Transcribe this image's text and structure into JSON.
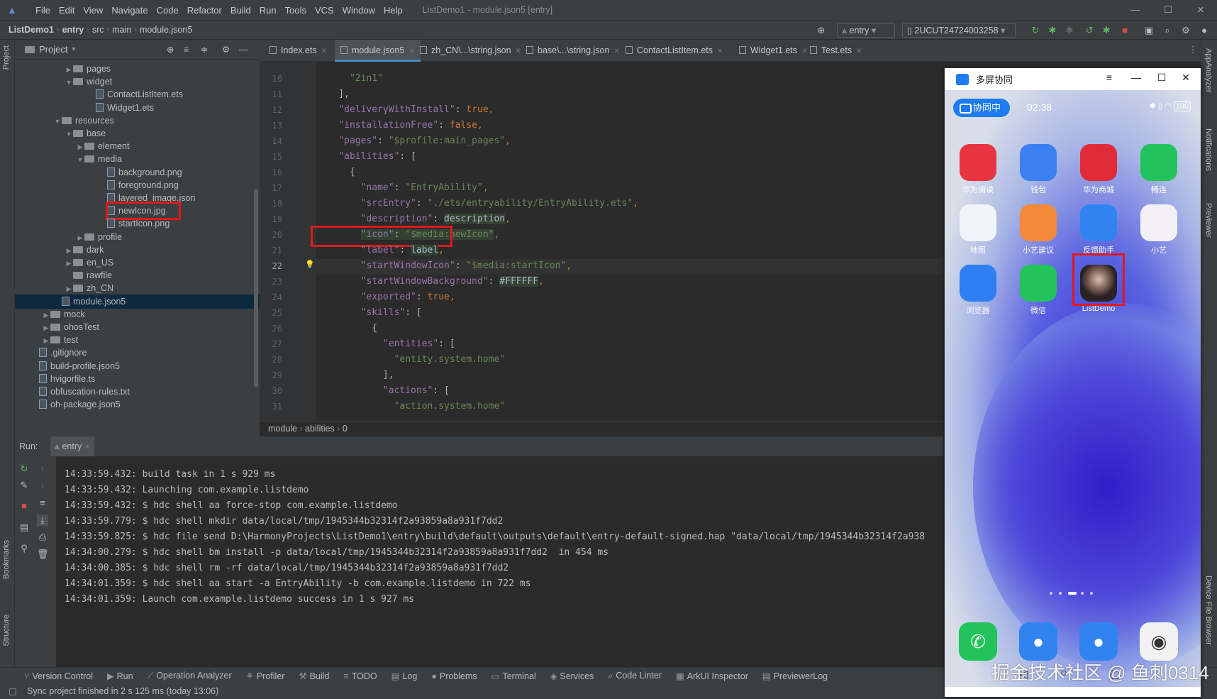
{
  "window": {
    "title": "ListDemo1 - module.json5 [entry]",
    "menu": [
      "File",
      "Edit",
      "View",
      "Navigate",
      "Code",
      "Refactor",
      "Build",
      "Run",
      "Tools",
      "VCS",
      "Window",
      "Help"
    ]
  },
  "navbar": {
    "breadcrumbs": [
      "ListDemo1",
      "entry",
      "src",
      "main",
      "module.json5"
    ],
    "run_config": "entry",
    "device": "2UCUT24724003258"
  },
  "project": {
    "title": "Project",
    "tree": [
      {
        "label": "pages",
        "kind": "folder",
        "depth": 5,
        "arrow": "right"
      },
      {
        "label": "widget",
        "kind": "folder",
        "depth": 5,
        "arrow": "down"
      },
      {
        "label": "ContactListItem.ets",
        "kind": "file",
        "depth": 7
      },
      {
        "label": "Widget1.ets",
        "kind": "file",
        "depth": 7
      },
      {
        "label": "resources",
        "kind": "folder",
        "depth": 4,
        "arrow": "down"
      },
      {
        "label": "base",
        "kind": "folder",
        "depth": 5,
        "arrow": "down"
      },
      {
        "label": "element",
        "kind": "folder",
        "depth": 6,
        "arrow": "right"
      },
      {
        "label": "media",
        "kind": "folder",
        "depth": 6,
        "arrow": "down"
      },
      {
        "label": "background.png",
        "kind": "file",
        "depth": 8
      },
      {
        "label": "foreground.png",
        "kind": "file",
        "depth": 8
      },
      {
        "label": "layered_image.json",
        "kind": "file",
        "depth": 8
      },
      {
        "label": "newIcon.jpg",
        "kind": "file",
        "depth": 8,
        "marked": true
      },
      {
        "label": "startIcon.png",
        "kind": "file",
        "depth": 8
      },
      {
        "label": "profile",
        "kind": "folder",
        "depth": 6,
        "arrow": "right"
      },
      {
        "label": "dark",
        "kind": "folder",
        "depth": 5,
        "arrow": "right"
      },
      {
        "label": "en_US",
        "kind": "folder",
        "depth": 5,
        "arrow": "right"
      },
      {
        "label": "rawfile",
        "kind": "folder",
        "depth": 5
      },
      {
        "label": "zh_CN",
        "kind": "folder",
        "depth": 5,
        "arrow": "right"
      },
      {
        "label": "module.json5",
        "kind": "file",
        "depth": 4,
        "selected": true
      },
      {
        "label": "mock",
        "kind": "folder",
        "depth": 3,
        "arrow": "right"
      },
      {
        "label": "ohosTest",
        "kind": "folder",
        "depth": 3,
        "arrow": "right"
      },
      {
        "label": "test",
        "kind": "folder",
        "depth": 3,
        "arrow": "right"
      },
      {
        "label": ".gitignore",
        "kind": "file",
        "depth": 2
      },
      {
        "label": "build-profile.json5",
        "kind": "file",
        "depth": 2
      },
      {
        "label": "hvigorfile.ts",
        "kind": "file",
        "depth": 2
      },
      {
        "label": "obfuscation-rules.txt",
        "kind": "file",
        "depth": 2
      },
      {
        "label": "oh-package.json5",
        "kind": "file",
        "depth": 2
      }
    ]
  },
  "tabs": [
    {
      "label": "Index.ets",
      "active": false
    },
    {
      "label": "module.json5",
      "active": true
    },
    {
      "label": "zh_CN\\...\\string.json",
      "active": false
    },
    {
      "label": "base\\...\\string.json",
      "active": false
    },
    {
      "label": "ContactListItem.ets",
      "active": false
    },
    {
      "label": "Widget1.ets",
      "active": false
    },
    {
      "label": "Test.ets",
      "active": false
    }
  ],
  "editor": {
    "lines": [
      {
        "n": 10,
        "segs": [
          [
            "      ",
            ""
          ],
          [
            "\"2in1\"",
            "s"
          ]
        ]
      },
      {
        "n": 11,
        "segs": [
          [
            "    ],",
            ""
          ]
        ]
      },
      {
        "n": 12,
        "segs": [
          [
            "    ",
            ""
          ],
          [
            "\"deliveryWithInstall\"",
            "k"
          ],
          [
            ": ",
            ""
          ],
          [
            "true",
            "b"
          ],
          [
            ",",
            "b"
          ]
        ]
      },
      {
        "n": 13,
        "segs": [
          [
            "    ",
            ""
          ],
          [
            "\"installationFree\"",
            "k"
          ],
          [
            ": ",
            ""
          ],
          [
            "false",
            "b"
          ],
          [
            ",",
            "b"
          ]
        ]
      },
      {
        "n": 14,
        "segs": [
          [
            "    ",
            ""
          ],
          [
            "\"pages\"",
            "k"
          ],
          [
            ": ",
            ""
          ],
          [
            "\"$profile:main_pages\"",
            "s"
          ],
          [
            ",",
            "b"
          ]
        ]
      },
      {
        "n": 15,
        "segs": [
          [
            "    ",
            ""
          ],
          [
            "\"abilities\"",
            "k"
          ],
          [
            ": [",
            ""
          ]
        ]
      },
      {
        "n": 16,
        "segs": [
          [
            "      {",
            ""
          ]
        ]
      },
      {
        "n": 17,
        "segs": [
          [
            "        ",
            ""
          ],
          [
            "\"name\"",
            "k"
          ],
          [
            ": ",
            ""
          ],
          [
            "\"EntryAbility\"",
            "s"
          ],
          [
            ",",
            "b"
          ]
        ]
      },
      {
        "n": 18,
        "segs": [
          [
            "        ",
            ""
          ],
          [
            "\"srcEntry\"",
            "k"
          ],
          [
            ": ",
            ""
          ],
          [
            "\"./ets/entryability/EntryAbility.ets\"",
            "s"
          ],
          [
            ",",
            "b"
          ]
        ]
      },
      {
        "n": 19,
        "segs": [
          [
            "        ",
            ""
          ],
          [
            "\"description\"",
            "k"
          ],
          [
            ": ",
            ""
          ],
          [
            "description",
            "hl"
          ],
          [
            ",",
            "b"
          ]
        ]
      },
      {
        "n": 20,
        "segs": [
          [
            "        ",
            ""
          ],
          [
            "\"icon\"",
            "k hl"
          ],
          [
            ": ",
            "hl"
          ],
          [
            "\"$media:newIcon\"",
            "s hl"
          ],
          [
            ",",
            "b"
          ]
        ]
      },
      {
        "n": 21,
        "segs": [
          [
            "        ",
            ""
          ],
          [
            "\"label\"",
            "k"
          ],
          [
            ": ",
            ""
          ],
          [
            "label",
            "hl"
          ],
          [
            ",",
            "b"
          ]
        ]
      },
      {
        "n": 22,
        "segs": [
          [
            "        ",
            ""
          ],
          [
            "\"startWindowIcon\"",
            "k"
          ],
          [
            ": ",
            ""
          ],
          [
            "\"$media:startIcon\"",
            "s"
          ],
          [
            ",",
            "b"
          ]
        ]
      },
      {
        "n": 23,
        "segs": [
          [
            "        ",
            ""
          ],
          [
            "\"startWindowBackground\"",
            "k"
          ],
          [
            ": ",
            ""
          ],
          [
            "#FFFFFF",
            "hl"
          ],
          [
            ",",
            "b"
          ]
        ]
      },
      {
        "n": 24,
        "segs": [
          [
            "        ",
            ""
          ],
          [
            "\"exported\"",
            "k"
          ],
          [
            ": ",
            ""
          ],
          [
            "true",
            "b"
          ],
          [
            ",",
            "b"
          ]
        ]
      },
      {
        "n": 25,
        "segs": [
          [
            "        ",
            ""
          ],
          [
            "\"skills\"",
            "k"
          ],
          [
            ": [",
            ""
          ]
        ]
      },
      {
        "n": 26,
        "segs": [
          [
            "          {",
            ""
          ]
        ]
      },
      {
        "n": 27,
        "segs": [
          [
            "            ",
            ""
          ],
          [
            "\"entities\"",
            "k"
          ],
          [
            ": [",
            ""
          ]
        ]
      },
      {
        "n": 28,
        "segs": [
          [
            "              ",
            ""
          ],
          [
            "\"entity.system.home\"",
            "s"
          ]
        ]
      },
      {
        "n": 29,
        "segs": [
          [
            "            ],",
            ""
          ]
        ]
      },
      {
        "n": 30,
        "segs": [
          [
            "            ",
            ""
          ],
          [
            "\"actions\"",
            "k"
          ],
          [
            ": [",
            ""
          ]
        ]
      },
      {
        "n": 31,
        "segs": [
          [
            "              ",
            ""
          ],
          [
            "\"action.system.home\"",
            "s"
          ]
        ]
      }
    ],
    "breadcrumb": [
      "module",
      "abilities",
      "0"
    ]
  },
  "run": {
    "label": "Run:",
    "config": "entry",
    "console": [
      "14:33:59.432: build task in 1 s 929 ms",
      "14:33:59.432: Launching com.example.listdemo",
      "14:33:59.432: $ hdc shell aa force-stop com.example.listdemo",
      "14:33:59.779: $ hdc shell mkdir data/local/tmp/1945344b32314f2a93859a8a931f7dd2",
      "14:33:59.825: $ hdc file send D:\\HarmonyProjects\\ListDemo1\\entry\\build\\default\\outputs\\default\\entry-default-signed.hap \"data/local/tmp/1945344b32314f2a938",
      "14:34:00.279: $ hdc shell bm install -p data/local/tmp/1945344b32314f2a93859a8a931f7dd2  in 454 ms",
      "14:34:00.385: $ hdc shell rm -rf data/local/tmp/1945344b32314f2a93859a8a931f7dd2",
      "14:34:01.359: $ hdc shell aa start -a EntryAbility -b com.example.listdemo in 722 ms",
      "14:34:01.359: Launch com.example.listdemo success in 1 s 927 ms"
    ]
  },
  "toolwindows": [
    "Version Control",
    "Run",
    "Operation Analyzer",
    "Profiler",
    "Build",
    "TODO",
    "Log",
    "Problems",
    "Terminal",
    "Services",
    "Code Linter",
    "ArkUI Inspector",
    "PreviewerLog"
  ],
  "status": "Sync project finished in 2 s 125 ms (today 13:06)",
  "side_labels": {
    "left": [
      "Project",
      "Bookmarks",
      "Structure"
    ],
    "right": [
      "AppAnalyzer",
      "Notifications",
      "Previewer",
      "Device File Browser"
    ]
  },
  "phone": {
    "window_title": "多屏协同",
    "collab_label": "协同中",
    "time": "02:38",
    "battery": "100",
    "apps": [
      {
        "label": "华为阅读",
        "icon": "huawei-read-icon",
        "color": "#e8343f"
      },
      {
        "label": "钱包",
        "icon": "wallet-icon",
        "color": "#3b7ff0"
      },
      {
        "label": "华为商城",
        "icon": "vmall-icon",
        "color": "#e22b39"
      },
      {
        "label": "畅连",
        "icon": "meetime-icon",
        "color": "#22c35b"
      },
      {
        "label": "地图",
        "icon": "map-icon",
        "color": "#f0f4f8"
      },
      {
        "label": "小艺建议",
        "icon": "celia-suggestion-icon",
        "color": "#f28a3a"
      },
      {
        "label": "反馈助手",
        "icon": "feedback-beta-icon",
        "color": "#2f84f2"
      },
      {
        "label": "小艺",
        "icon": "celia-icon",
        "color": "#f4f1f6"
      },
      {
        "label": "浏览器",
        "icon": "browser-icon",
        "color": "#2f7ef2"
      },
      {
        "label": "微信",
        "icon": "wechat-icon",
        "color": "#22c35b"
      },
      {
        "label": "ListDemo",
        "icon": "listdemo-avatar-icon",
        "color": "#3a3030",
        "marked": true
      }
    ],
    "dock": [
      {
        "icon": "phone-call-icon",
        "color": "#22c35b"
      },
      {
        "icon": "contacts-icon",
        "color": "#2f84f2"
      },
      {
        "icon": "messages-icon",
        "color": "#2f84f2"
      },
      {
        "icon": "camera-icon",
        "color": "#f2f2f2"
      }
    ]
  },
  "watermark": "掘金技术社区 @ 鱼刺0314"
}
